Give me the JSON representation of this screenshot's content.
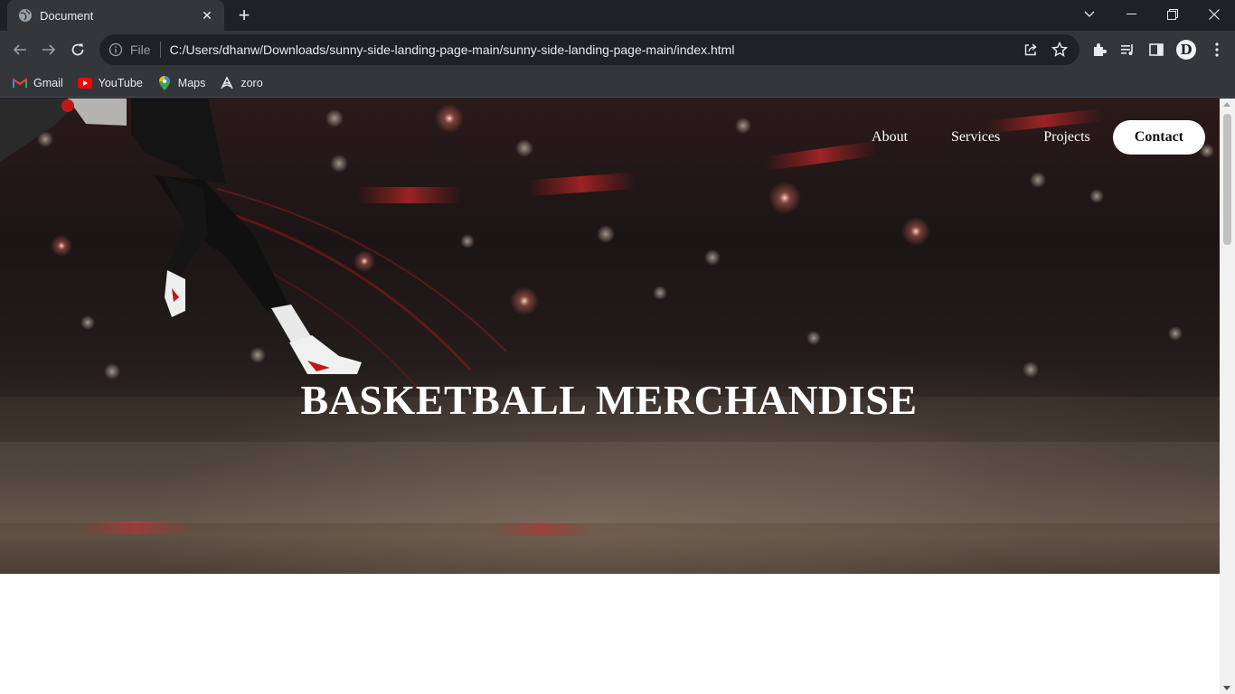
{
  "browser": {
    "tab": {
      "title": "Document",
      "favicon": "globe-icon"
    },
    "omnibox": {
      "scheme": "File",
      "url": "C:/Users/dhanw/Downloads/sunny-side-landing-page-main/sunny-side-landing-page-main/index.html"
    },
    "profile_initial": "D",
    "bookmarks": [
      {
        "label": "Gmail",
        "icon": "gmail-icon"
      },
      {
        "label": "YouTube",
        "icon": "youtube-icon"
      },
      {
        "label": "Maps",
        "icon": "maps-icon"
      },
      {
        "label": "zoro",
        "icon": "zoro-icon"
      }
    ]
  },
  "page": {
    "nav": {
      "about": "About",
      "services": "Services",
      "projects": "Projects",
      "contact": "Contact"
    },
    "hero": {
      "headline": "BASKETBALL MERCHANDISE",
      "background": "dark arena crowd with basketball player dunking"
    }
  },
  "colors": {
    "chrome_dark": "#202124",
    "chrome_toolbar": "#35363a",
    "nav_text": "#ffffff",
    "contact_bg": "#ffffff"
  }
}
